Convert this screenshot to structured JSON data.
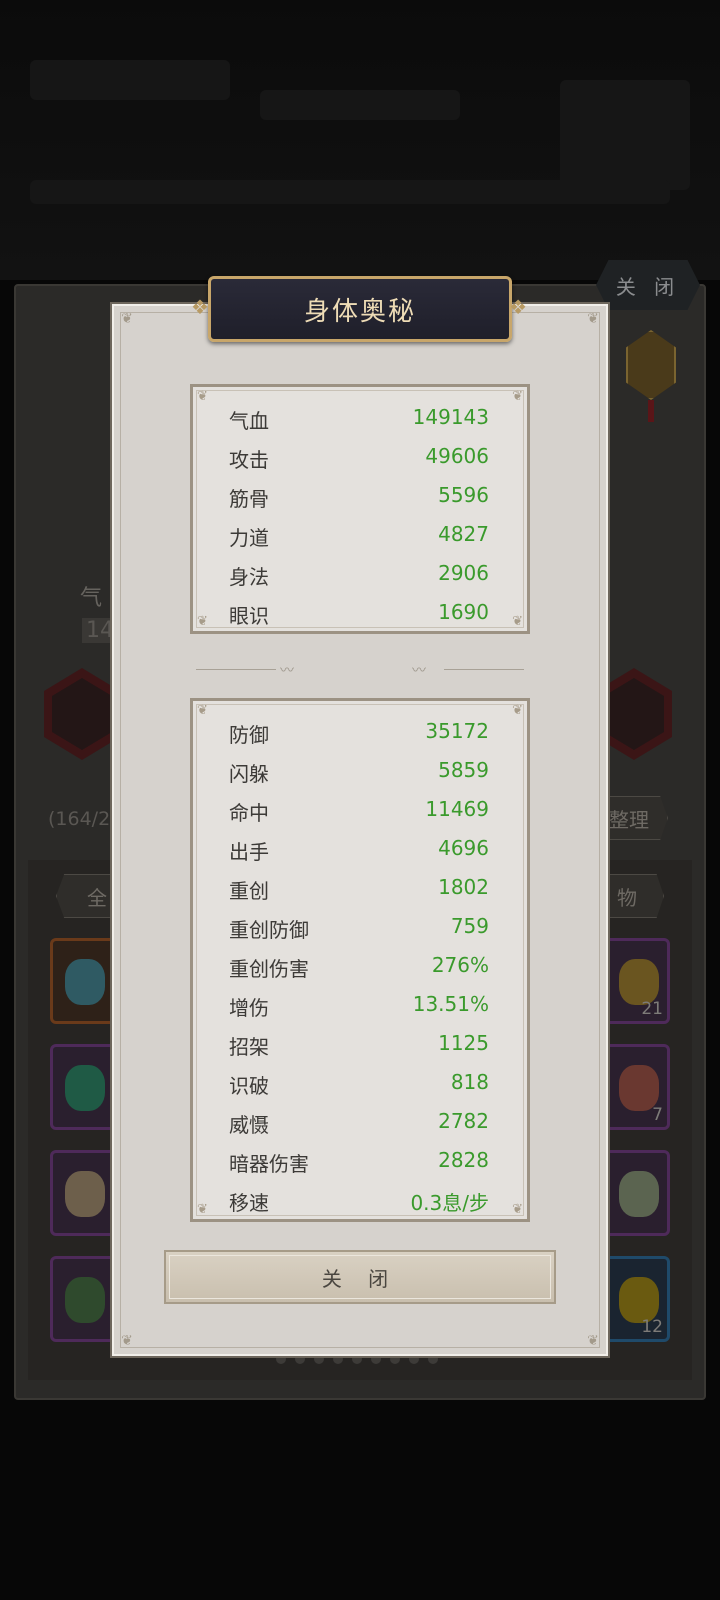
{
  "background": {
    "close_label": "关 闭",
    "hp_label": "气",
    "hp_value_fragment": "14",
    "capacity_fragment": "(164/2",
    "sort_label": "整理",
    "tab_all_fragment": "全",
    "tab_item_fragment": "物",
    "slot_counts": [
      "21",
      "7",
      "12"
    ],
    "page_dot_count": 9
  },
  "modal": {
    "title": "身体奥秘",
    "close_label": "关 闭",
    "primary_stats": [
      {
        "name": "气血",
        "value": "149143"
      },
      {
        "name": "攻击",
        "value": "49606"
      },
      {
        "name": "筋骨",
        "value": "5596"
      },
      {
        "name": "力道",
        "value": "4827"
      },
      {
        "name": "身法",
        "value": "2906"
      },
      {
        "name": "眼识",
        "value": "1690"
      }
    ],
    "secondary_stats": [
      {
        "name": "防御",
        "value": "35172"
      },
      {
        "name": "闪躲",
        "value": "5859"
      },
      {
        "name": "命中",
        "value": "11469"
      },
      {
        "name": "出手",
        "value": "4696"
      },
      {
        "name": "重创",
        "value": "1802"
      },
      {
        "name": "重创防御",
        "value": "759"
      },
      {
        "name": "重创伤害",
        "value": "276%"
      },
      {
        "name": "增伤",
        "value": "13.51%"
      },
      {
        "name": "招架",
        "value": "1125"
      },
      {
        "name": "识破",
        "value": "818"
      },
      {
        "name": "威慑",
        "value": "2782"
      },
      {
        "name": "暗器伤害",
        "value": "2828"
      },
      {
        "name": "移速",
        "value": "0.3息/步"
      }
    ]
  },
  "colors": {
    "value_green": "#3a9a2c",
    "title_gold": "#eedcb6",
    "panel_bg": "#d6d2cd"
  }
}
